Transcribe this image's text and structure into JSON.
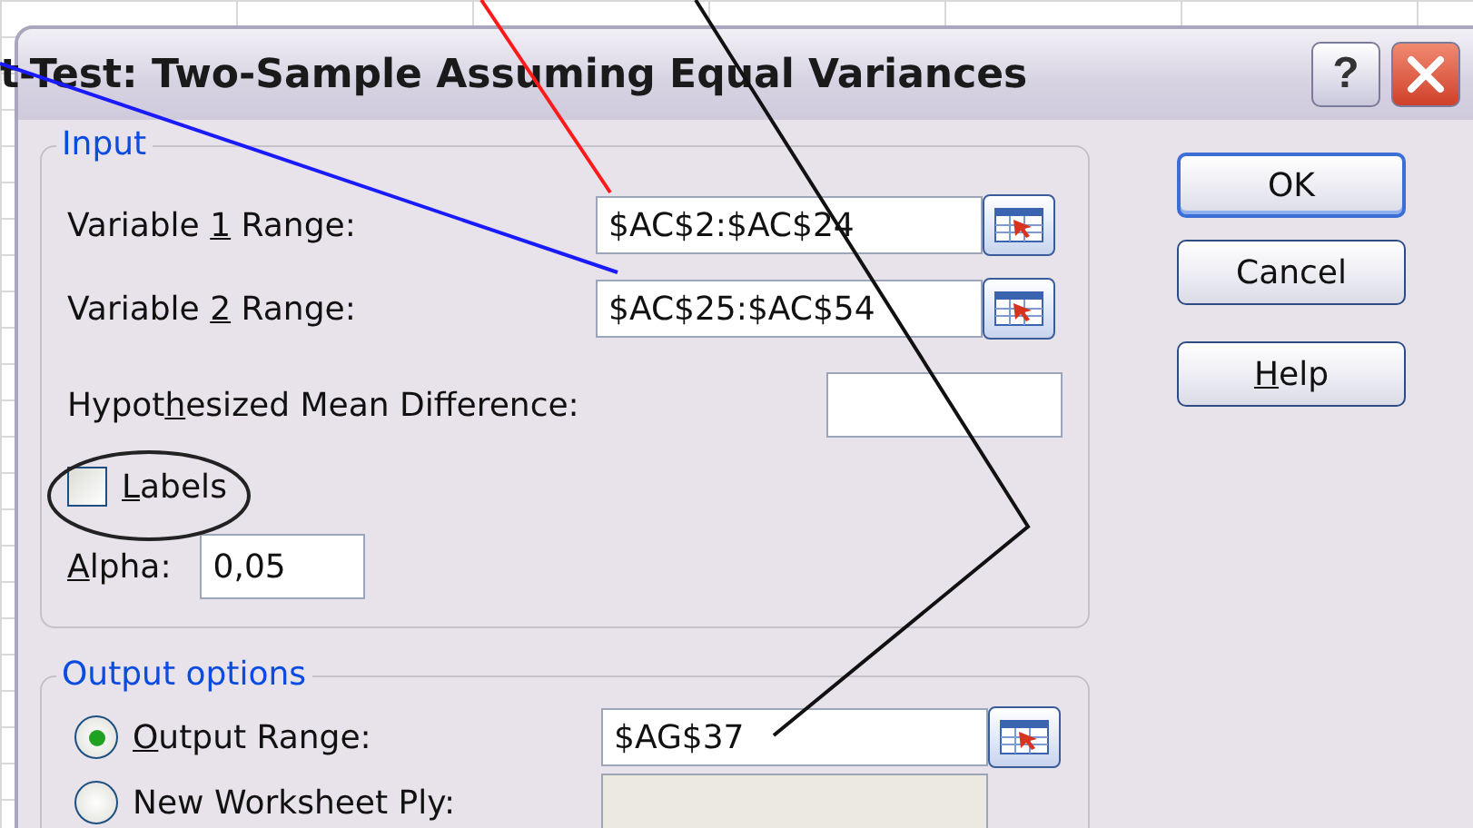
{
  "window": {
    "title": "t-Test: Two-Sample Assuming Equal Variances",
    "help_glyph": "?"
  },
  "input": {
    "legend": "Input",
    "rows": [
      {
        "kind": "range",
        "label": {
          "pre": "Variable ",
          "key": "1",
          "post": " Range:"
        },
        "value": "$AC$2:$AC$24"
      },
      {
        "kind": "range",
        "label": {
          "pre": "Variable ",
          "key": "2",
          "post": " Range:"
        },
        "value": "$AC$25:$AC$54"
      },
      {
        "kind": "text",
        "label": {
          "pre": "Hypot",
          "key": "h",
          "post": "esized Mean Difference:"
        }
      },
      {
        "kind": "checkbox",
        "label": {
          "key": "L",
          "post": "abels"
        },
        "checked": false
      },
      {
        "kind": "short",
        "label": {
          "key": "A",
          "post": "lpha:"
        },
        "value": "0,05"
      }
    ]
  },
  "output": {
    "legend": "Output options",
    "rows": [
      {
        "kind": "radio",
        "label": {
          "key": "O",
          "post": "utput Range:"
        },
        "selected": true,
        "disabled": false,
        "value": "$AG$37"
      },
      {
        "kind": "radio",
        "label": {
          "pre": "New Worksheet Ply:"
        },
        "selected": false,
        "disabled": true
      }
    ]
  },
  "buttons": [
    {
      "label": {
        "pre": "OK"
      },
      "default": true
    },
    {
      "label": {
        "pre": "Cancel"
      },
      "default": false
    },
    {
      "label": {
        "key": "H",
        "post": "elp"
      },
      "default": false
    }
  ]
}
